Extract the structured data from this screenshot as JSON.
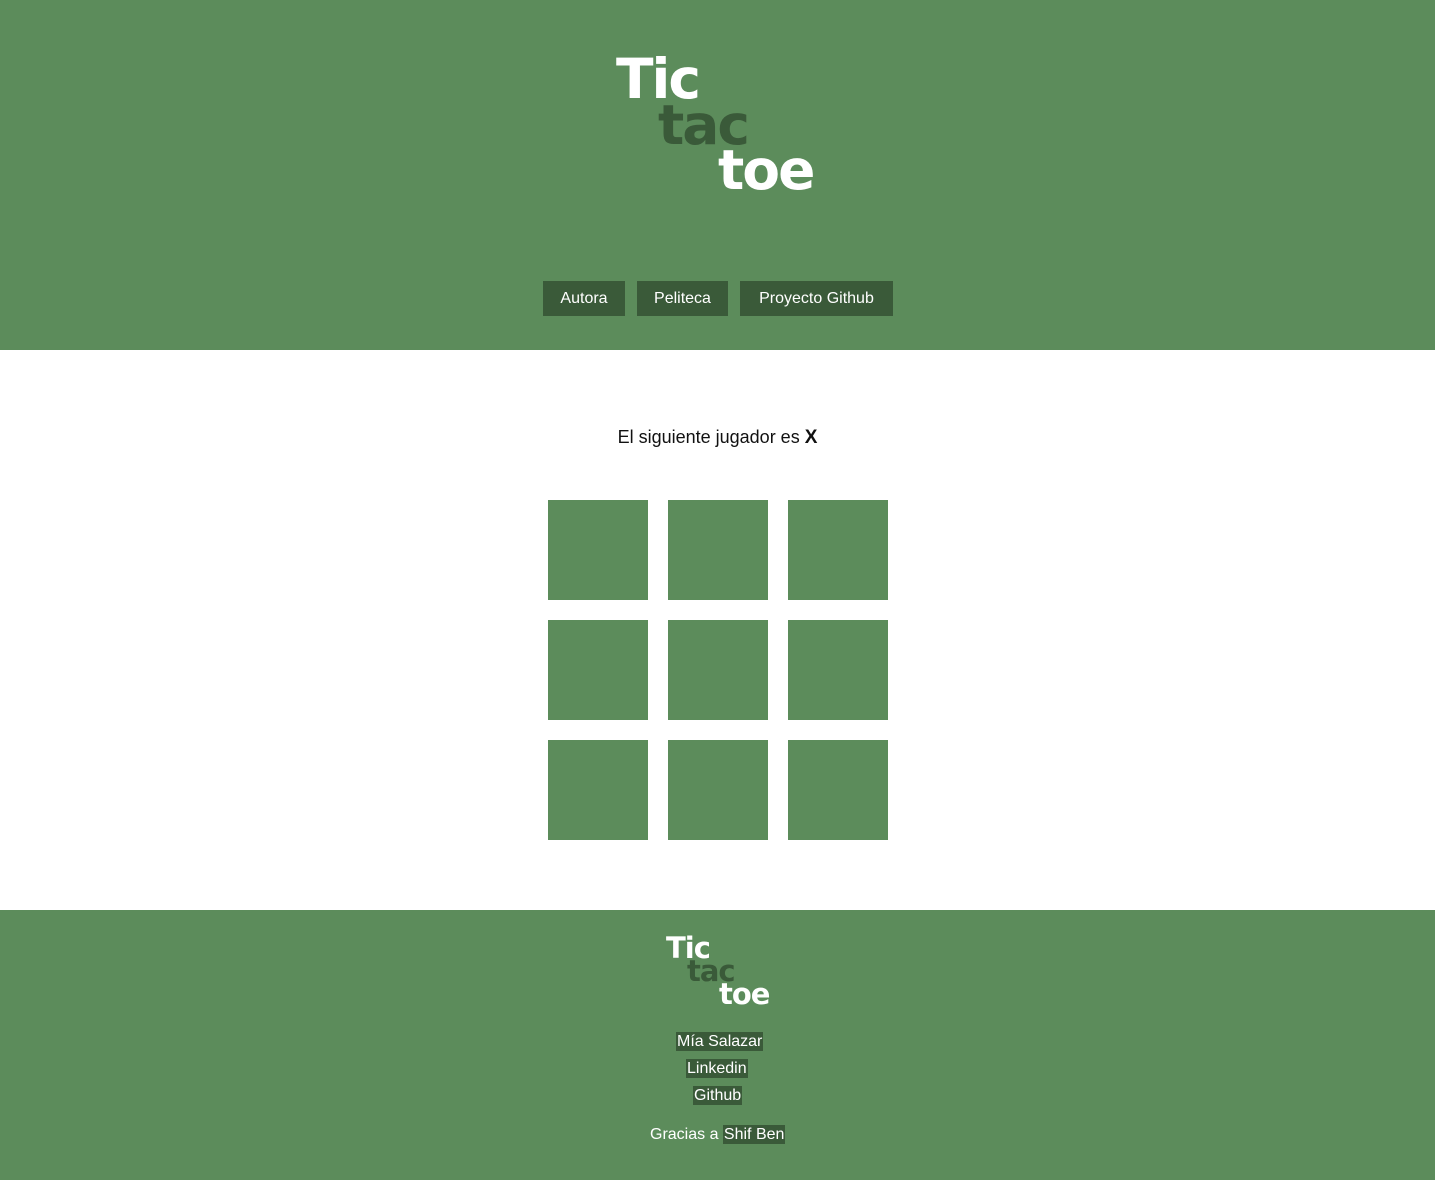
{
  "logo": {
    "line1": "Tic",
    "line2": "tac",
    "line3": "toe"
  },
  "nav": {
    "items": [
      {
        "label": "Autora"
      },
      {
        "label": "Peliteca"
      },
      {
        "label": "Proyecto Github"
      }
    ]
  },
  "game": {
    "status_prefix": "El siguiente jugador es",
    "next_player": "X",
    "board": [
      "",
      "",
      "",
      "",
      "",
      "",
      "",
      "",
      ""
    ]
  },
  "footer": {
    "links": [
      {
        "label": "Mía Salazar"
      },
      {
        "label": "Linkedin"
      },
      {
        "label": "Github"
      }
    ],
    "thanks_prefix": "Gracias a",
    "thanks_link": "Shif Ben"
  },
  "colors": {
    "primary_green": "#5c8c5b",
    "dark_green": "#3a5a39",
    "white": "#ffffff"
  }
}
